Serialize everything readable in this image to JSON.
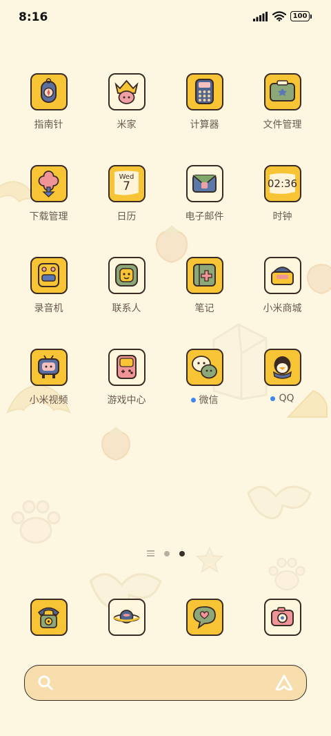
{
  "status_bar": {
    "time": "8:16",
    "battery": "100"
  },
  "apps": [
    {
      "label": "指南针",
      "icon": "compass-icon"
    },
    {
      "label": "米家",
      "icon": "mijia-icon"
    },
    {
      "label": "计算器",
      "icon": "calculator-icon"
    },
    {
      "label": "文件管理",
      "icon": "file-manager-icon"
    },
    {
      "label": "下载管理",
      "icon": "download-icon"
    },
    {
      "label": "日历",
      "icon": "calendar-icon",
      "day": "Wed",
      "date": "7"
    },
    {
      "label": "电子邮件",
      "icon": "email-icon"
    },
    {
      "label": "时钟",
      "icon": "clock-icon",
      "clock": "02:36"
    },
    {
      "label": "录音机",
      "icon": "recorder-icon"
    },
    {
      "label": "联系人",
      "icon": "contacts-icon"
    },
    {
      "label": "笔记",
      "icon": "notes-icon"
    },
    {
      "label": "小米商城",
      "icon": "mi-store-icon"
    },
    {
      "label": "小米视频",
      "icon": "mi-video-icon"
    },
    {
      "label": "游戏中心",
      "icon": "game-center-icon"
    },
    {
      "label": "微信",
      "icon": "wechat-icon",
      "new_badge": true
    },
    {
      "label": "QQ",
      "icon": "qq-icon",
      "new_badge": true
    }
  ],
  "dock": [
    {
      "icon": "phone-icon"
    },
    {
      "icon": "browser-icon"
    },
    {
      "icon": "messages-icon"
    },
    {
      "icon": "camera-icon"
    }
  ],
  "page_indicator": {
    "pages": 3,
    "current": 2
  },
  "colors": {
    "background": "#fdf6e0",
    "tile_yellow": "#f6c434",
    "outline": "#3a2a24",
    "badge": "#3e86f0",
    "search_bar": "#f7deac"
  }
}
